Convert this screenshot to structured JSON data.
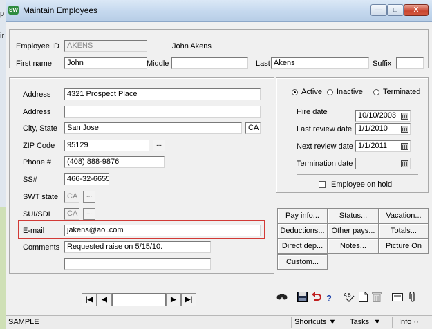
{
  "background": {
    "left_text_1": "p",
    "left_text_2": "ir"
  },
  "window": {
    "title": "Maintain Employees",
    "icon": "app-icon",
    "controls": {
      "minimize": "—",
      "maximize": "□",
      "close": "X"
    }
  },
  "identity": {
    "employee_id_label": "Employee ID",
    "employee_id": "AKENS",
    "full_name": "John Akens",
    "first_name_label": "First name",
    "first_name": "John",
    "middle_label": "Middle",
    "middle": "",
    "last_label": "Last",
    "last": "Akens",
    "suffix_label": "Suffix",
    "suffix": ""
  },
  "address": {
    "address1_label": "Address",
    "address1": "4321 Prospect Place",
    "address2_label": "Address",
    "address2": "",
    "city_state_label": "City, State",
    "city": "San Jose",
    "state": "CA",
    "zip_label": "ZIP Code",
    "zip": "95129",
    "lookup_button": "...",
    "phone_label": "Phone #",
    "phone": "(408) 888-9876",
    "ss_label": "SS#",
    "ss": "466-32-6655",
    "swt_label": "SWT state",
    "swt": "CA",
    "sui_label": "SUI/SDI",
    "sui": "CA",
    "email_label": "E-mail",
    "email": "jakens@aol.com",
    "comments_label": "Comments",
    "comments1": "Requested raise on 5/15/10.",
    "comments2": ""
  },
  "status": {
    "active": "Active",
    "inactive": "Inactive",
    "terminated": "Terminated",
    "selected": "Active",
    "hire_label": "Hire date",
    "hire": "10/10/2003",
    "last_review_label": "Last review date",
    "last_review": "1/1/2010",
    "next_review_label": "Next review date",
    "next_review": "1/1/2011",
    "termination_label": "Termination date",
    "termination": "",
    "on_hold_label": "Employee on hold"
  },
  "buttons": {
    "pay_info": "Pay info...",
    "status": "Status...",
    "vacation": "Vacation...",
    "deductions": "Deductions...",
    "other_pays": "Other pays...",
    "totals": "Totals...",
    "direct_dep": "Direct dep...",
    "notes": "Notes...",
    "picture_on": "Picture On",
    "custom": "Custom..."
  },
  "nav": {
    "first": "|◀",
    "prev": "◀",
    "record": "",
    "next": "▶",
    "last": "▶|"
  },
  "toolbar": {
    "find": "find-icon",
    "save": "save-icon",
    "undo": "undo-icon",
    "help": "help-icon",
    "spell": "spell-icon",
    "new": "new-icon",
    "delete": "delete-icon",
    "email": "email-icon",
    "attach": "attach-icon"
  },
  "statusbar": {
    "company": "SAMPLE",
    "shortcuts": "Shortcuts",
    "tasks": "Tasks",
    "info": "Info"
  },
  "colors": {
    "highlight": "#d23a36",
    "title_gradient": "#c4d8ee"
  }
}
